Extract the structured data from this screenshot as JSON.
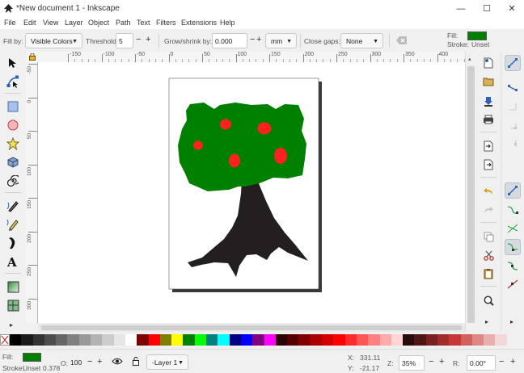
{
  "window": {
    "title": "*New document 1 - Inkscape",
    "minimize_glyph": "—",
    "maximize_glyph": "☐",
    "close_glyph": "✕"
  },
  "menu": [
    "File",
    "Edit",
    "View",
    "Layer",
    "Object",
    "Path",
    "Text",
    "Filters",
    "Extensions",
    "Help"
  ],
  "toolcontrols": {
    "fill_by_label": "Fill by:",
    "fill_by_value": "Visible Colors",
    "threshold_label": "Threshold:",
    "threshold_value": "5",
    "grow_label": "Grow/shrink by:",
    "grow_value": "0.000",
    "unit_value": "mm",
    "close_gaps_label": "Close gaps:",
    "close_gaps_value": "None",
    "minus": "−",
    "plus": "+"
  },
  "style_indicator": {
    "fill_label": "Fill:",
    "stroke_label": "Stroke:",
    "stroke_value": "Unset",
    "fill_color": "#008000"
  },
  "hruler_ticks": [
    "-150",
    "-100",
    "-50",
    "0",
    "50",
    "100",
    "150",
    "200",
    "250",
    "300",
    "350",
    "400"
  ],
  "vruler_ticks": [
    "-50",
    "0",
    "50",
    "100",
    "150",
    "200",
    "250",
    "300",
    "350"
  ],
  "drawing": {
    "canopy_color": "#008000",
    "fruit_color": "#ff2020",
    "trunk_color": "#231f20"
  },
  "statusbar": {
    "fill_label": "Fill:",
    "stroke_label": "Stroke:",
    "stroke_value": "Unset",
    "stroke_width": "0.378",
    "fill_color": "#008000",
    "opacity_label": "O:",
    "opacity_value": "100",
    "layer_value": "-Layer 1",
    "x_label": "X:",
    "x_value": "331.11",
    "y_label": "Y:",
    "y_value": "-21.17",
    "zoom_label": "Z:",
    "zoom_value": "35%",
    "rotate_label": "R:",
    "rotate_value": "0.00°"
  },
  "palette": [
    "#000000",
    "#1a1a1a",
    "#333333",
    "#4d4d4d",
    "#666666",
    "#808080",
    "#999999",
    "#b3b3b3",
    "#cccccc",
    "#e6e6e6",
    "#ffffff",
    "#800000",
    "#ff0000",
    "#808000",
    "#ffff00",
    "#008000",
    "#00ff00",
    "#008080",
    "#00ffff",
    "#000080",
    "#0000ff",
    "#800080",
    "#ff00ff",
    "#2b0000",
    "#550000",
    "#800000",
    "#aa0000",
    "#d40000",
    "#ff0000",
    "#ff2a2a",
    "#ff5555",
    "#ff8080",
    "#ffaaaa",
    "#ffd5d5",
    "#280b0b",
    "#501616",
    "#782121",
    "#a02c2c",
    "#c83737",
    "#d35f5f",
    "#de8787",
    "#e9afaf",
    "#f4d7d7"
  ]
}
